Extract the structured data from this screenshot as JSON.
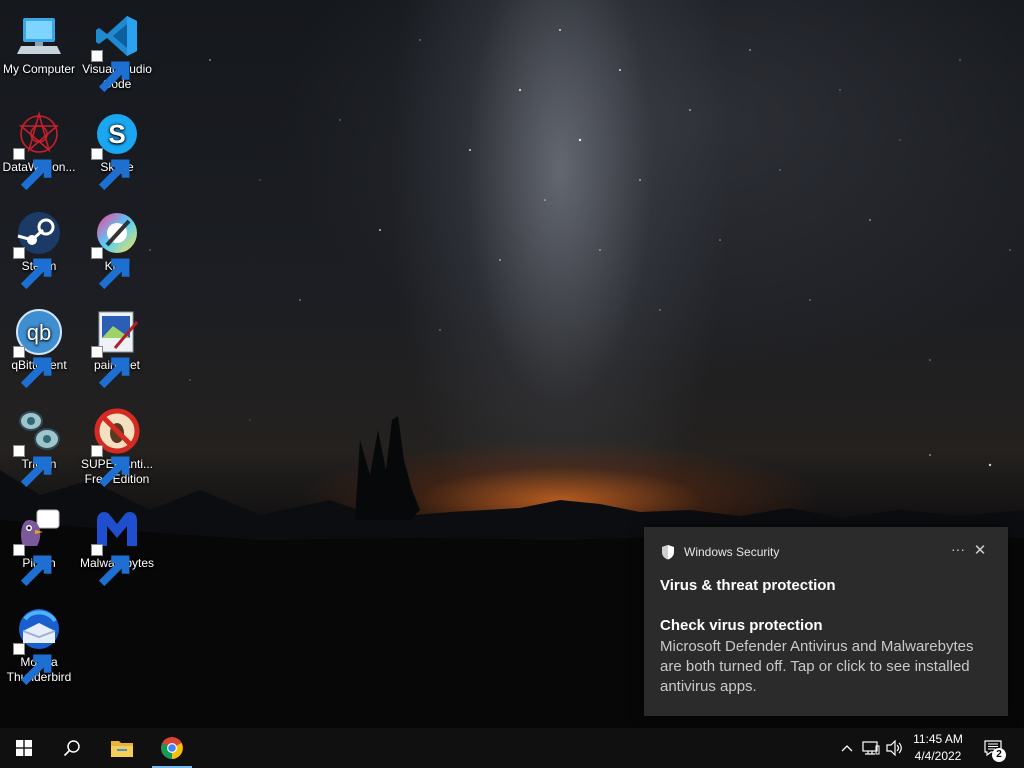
{
  "desktop": {
    "icons": [
      {
        "label": "My Computer",
        "icon": "computer-icon",
        "shortcut": false
      },
      {
        "label": "Visual Studio Code",
        "icon": "vscode-icon",
        "shortcut": true
      },
      {
        "label": "DataWagon...",
        "icon": "datawagon-icon",
        "shortcut": true
      },
      {
        "label": "Skype",
        "icon": "skype-icon",
        "shortcut": true
      },
      {
        "label": "Steam",
        "icon": "steam-icon",
        "shortcut": true
      },
      {
        "label": "Krita",
        "icon": "krita-icon",
        "shortcut": true
      },
      {
        "label": "qBittorrent",
        "icon": "qbittorrent-icon",
        "shortcut": true
      },
      {
        "label": "paint.net",
        "icon": "paintnet-icon",
        "shortcut": true
      },
      {
        "label": "Trillian",
        "icon": "trillian-icon",
        "shortcut": true
      },
      {
        "label": "SUPERAnti... Free Edition",
        "icon": "superantispyware-icon",
        "shortcut": true
      },
      {
        "label": "Pidgin",
        "icon": "pidgin-icon",
        "shortcut": true
      },
      {
        "label": "Malwarebytes",
        "icon": "malwarebytes-icon",
        "shortcut": true
      },
      {
        "label": "Mozilla Thunderbird",
        "icon": "thunderbird-icon",
        "shortcut": true
      }
    ]
  },
  "notification": {
    "app": "Windows Security",
    "more": "···",
    "close": "✕",
    "title": "Virus & threat protection",
    "subtitle": "Check virus protection",
    "body": "Microsoft Defender Antivirus and Malwarebytes are both turned off. Tap or click to see installed antivirus apps."
  },
  "taskbar": {
    "buttons": [
      "start-icon",
      "search-icon",
      "file-explorer-icon",
      "chrome-icon"
    ],
    "active": "chrome-icon",
    "tray": [
      "chevron-up-icon",
      "network-icon",
      "volume-icon"
    ],
    "time": "11:45 AM",
    "date": "4/4/2022",
    "notification_count": "2"
  },
  "colors": {
    "toast_bg": "#2b2b2b",
    "taskbar_bg": "#101010",
    "accent": "#76b9ed"
  }
}
